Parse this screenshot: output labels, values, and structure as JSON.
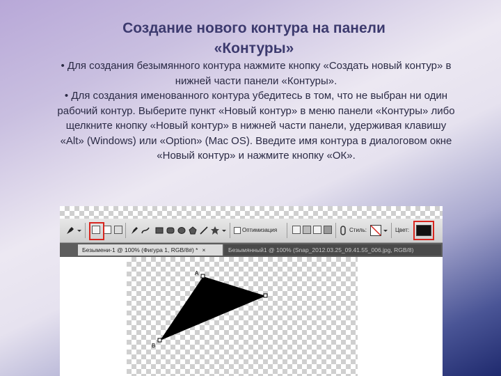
{
  "slide": {
    "title_line1": "Создание нового контура на панели",
    "title_line2": "«Контуры»",
    "bullet1": "• Для создания безымянного контура нажмите кнопку «Создать новый контур»  в нижней части панели «Контуры».",
    "bullet2": "• Для создания именованного контура убедитесь в том, что не выбран ни один рабочий контур. Выберите пункт «Новый контур» в меню панели «Контуры» либо щелкните кнопку «Новый контур» в нижней части панели, удерживая клавишу «Alt» (Windows) или «Option» (Mac OS). Введите имя контура в диалоговом окне «Новый контур» и нажмите кнопку «ОК»."
  },
  "toolbar": {
    "auto_add_delete_label": "Оптимизация",
    "style_label": "Стиль:",
    "color_label": "Цвет:",
    "swatch_color": "#111111",
    "highlight_color": "#d8261f",
    "icons": [
      "pen-tool-icon",
      "shape-layers-icon",
      "paths-icon",
      "fill-pixels-icon",
      "pen-icon",
      "freeform-pen-icon",
      "rectangle-icon",
      "rounded-rectangle-icon",
      "ellipse-icon",
      "polygon-icon",
      "line-icon",
      "custom-shape-icon",
      "add-mode-icon",
      "subtract-mode-icon",
      "intersect-mode-icon",
      "exclude-mode-icon",
      "link-icon"
    ]
  },
  "tabs": [
    {
      "label": "Безымени-1 @ 100% (Фигура 1, RGB/8#) *",
      "close": "×",
      "active": true
    },
    {
      "label": "Безымянный1 @ 100% (Snap_2012.03.25_09.41.55_006.jpg, RGB/8)",
      "close": "",
      "active": false
    }
  ],
  "canvas": {
    "shape_color": "#000000",
    "anchor_labels": [
      "A",
      "B"
    ]
  }
}
